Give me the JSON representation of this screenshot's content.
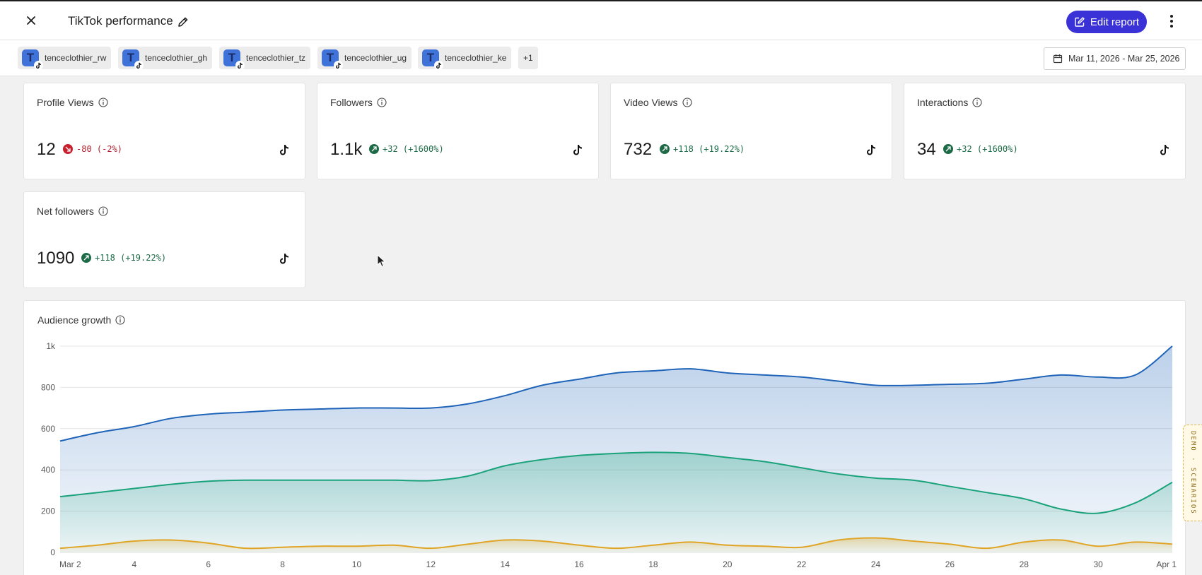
{
  "header": {
    "title": "TikTok performance",
    "edit_report_label": "Edit report"
  },
  "filters": {
    "accounts": [
      {
        "initial": "T",
        "name": "tenceclothier_rw"
      },
      {
        "initial": "T",
        "name": "tenceclothier_gh"
      },
      {
        "initial": "T",
        "name": "tenceclothier_tz"
      },
      {
        "initial": "T",
        "name": "tenceclothier_ug"
      },
      {
        "initial": "T",
        "name": "tenceclothier_ke"
      }
    ],
    "more_label": "+1",
    "date_range": "Mar 11, 2026 - Mar 25, 2026"
  },
  "metrics": [
    {
      "label": "Profile Views",
      "value": "12",
      "delta": "-80 (-2%)",
      "trend": "down"
    },
    {
      "label": "Followers",
      "value": "1.1k",
      "delta": "+32 (+1600%)",
      "trend": "up"
    },
    {
      "label": "Video Views",
      "value": "732",
      "delta": "+118 (+19.22%)",
      "trend": "up"
    },
    {
      "label": "Interactions",
      "value": "34",
      "delta": "+32 (+1600%)",
      "trend": "up"
    },
    {
      "label": "Net followers",
      "value": "1090",
      "delta": "+118 (+19.22%)",
      "trend": "up"
    }
  ],
  "audience_growth": {
    "title": "Audience growth"
  },
  "demo_tab": "DEMO · SCENARIOS",
  "colors": {
    "accent": "#3a32d6",
    "series_blue": "#1f64b8",
    "series_green": "#1aa37a",
    "series_yellow": "#e0a526",
    "up": "#1d6b46",
    "down": "#c8202e"
  },
  "icons": [
    "close-icon",
    "pencil-icon",
    "edit-report-icon",
    "kebab-icon",
    "calendar-icon",
    "info-icon",
    "tiktok-icon",
    "trend-up-icon",
    "trend-down-icon"
  ],
  "chart_data": {
    "type": "area",
    "x": [
      "Mar 2",
      "Mar 3",
      "Mar 4",
      "Mar 5",
      "Mar 6",
      "Mar 7",
      "Mar 8",
      "Mar 9",
      "Mar 10",
      "Mar 11",
      "Mar 12",
      "Mar 13",
      "Mar 14",
      "Mar 15",
      "Mar 16",
      "Mar 17",
      "Mar 18",
      "Mar 19",
      "Mar 20",
      "Mar 21",
      "Mar 22",
      "Mar 23",
      "Mar 24",
      "Mar 25",
      "Mar 26",
      "Mar 27",
      "Mar 28",
      "Mar 29",
      "Mar 30",
      "Mar 31",
      "Apr 1"
    ],
    "x_tick_labels": [
      "Mar 2",
      "4",
      "6",
      "8",
      "10",
      "12",
      "14",
      "16",
      "18",
      "20",
      "22",
      "24",
      "26",
      "28",
      "30",
      "Apr 1"
    ],
    "y_tick_labels": [
      "0",
      "200",
      "400",
      "600",
      "800",
      "1k"
    ],
    "ylim": [
      0,
      1000
    ],
    "grid": true,
    "series": [
      {
        "color": "#1f64b8",
        "values": [
          540,
          580,
          610,
          650,
          670,
          680,
          690,
          695,
          700,
          700,
          700,
          720,
          760,
          810,
          840,
          870,
          880,
          890,
          870,
          860,
          850,
          830,
          810,
          810,
          815,
          820,
          840,
          860,
          850,
          860,
          1000
        ]
      },
      {
        "color": "#1aa37a",
        "values": [
          270,
          290,
          310,
          330,
          345,
          350,
          350,
          350,
          350,
          350,
          348,
          370,
          420,
          450,
          470,
          480,
          485,
          480,
          460,
          440,
          410,
          380,
          360,
          350,
          320,
          290,
          260,
          210,
          190,
          240,
          340
        ]
      },
      {
        "color": "#e0a526",
        "values": [
          20,
          35,
          55,
          60,
          45,
          20,
          25,
          30,
          30,
          35,
          20,
          40,
          60,
          55,
          35,
          20,
          35,
          50,
          35,
          30,
          25,
          60,
          70,
          55,
          40,
          20,
          50,
          60,
          30,
          50,
          40
        ]
      }
    ]
  }
}
